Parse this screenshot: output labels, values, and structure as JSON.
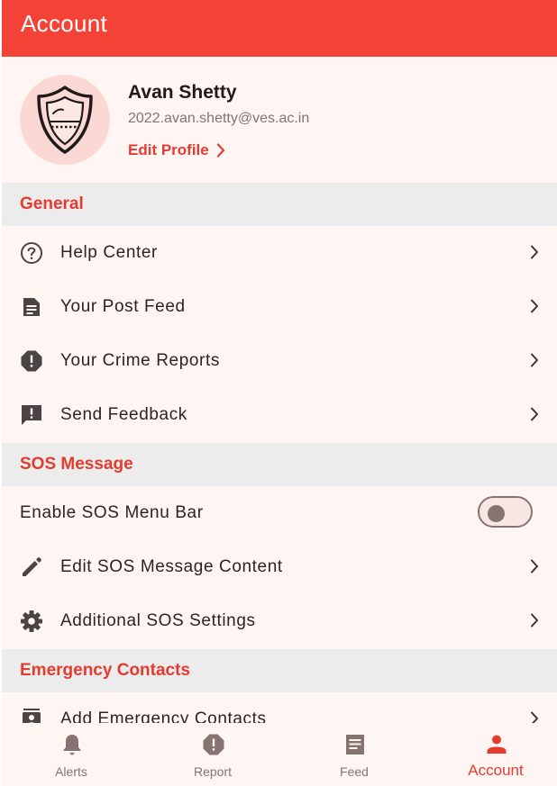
{
  "app_bar": {
    "title": "Account"
  },
  "profile": {
    "name": "Avan Shetty",
    "email": "2022.avan.shetty@ves.ac.in",
    "edit_label": "Edit Profile"
  },
  "sections": {
    "general": {
      "title": "General",
      "items": [
        {
          "label": "Help Center",
          "icon": "help-circle-icon"
        },
        {
          "label": "Your Post Feed",
          "icon": "article-icon"
        },
        {
          "label": "Your Crime Reports",
          "icon": "report-icon"
        },
        {
          "label": "Send Feedback",
          "icon": "feedback-icon"
        }
      ]
    },
    "sos": {
      "title": "SOS Message",
      "toggle": {
        "label": "Enable SOS Menu Bar",
        "enabled": false
      },
      "items": [
        {
          "label": "Edit SOS Message Content",
          "icon": "pencil-icon"
        },
        {
          "label": "Additional SOS Settings",
          "icon": "gear-icon"
        }
      ]
    },
    "emergency": {
      "title": "Emergency Contacts",
      "items": [
        {
          "label": "Add Emergency Contacts",
          "icon": "contact-icon"
        }
      ]
    }
  },
  "bottom_nav": {
    "items": [
      {
        "label": "Alerts",
        "icon": "bell-icon",
        "active": false
      },
      {
        "label": "Report",
        "icon": "report-icon",
        "active": false
      },
      {
        "label": "Feed",
        "icon": "article-icon",
        "active": false
      },
      {
        "label": "Account",
        "icon": "person-icon",
        "active": true
      }
    ]
  },
  "colors": {
    "primary": "#f44336",
    "accent_text": "#e53b2f",
    "background": "#fff5f3",
    "section_bg": "#ececec",
    "avatar_bg": "#fbd8d3",
    "muted": "#857472"
  }
}
